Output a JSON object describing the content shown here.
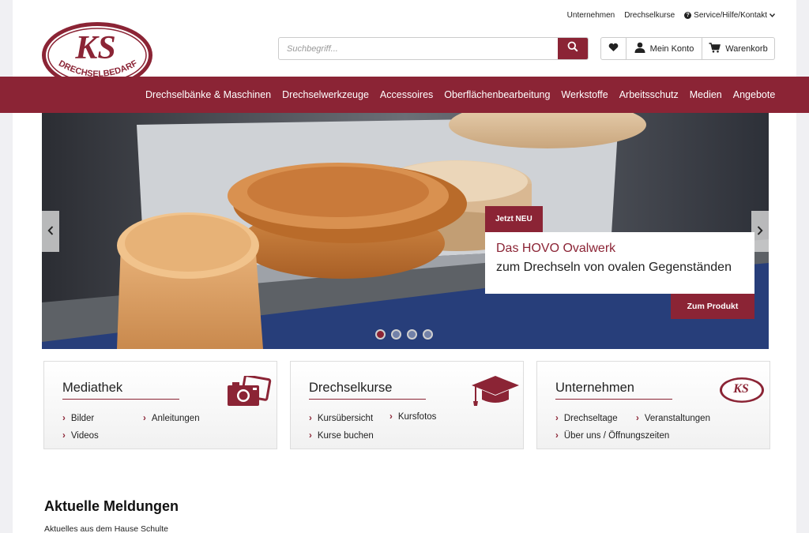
{
  "top_links": {
    "company": "Unternehmen",
    "courses": "Drechselkurse",
    "service": "Service/Hilfe/Kontakt"
  },
  "logo": {
    "initials": "KS",
    "name": "DRECHSELBEDARF"
  },
  "search": {
    "placeholder": "Suchbegriff..."
  },
  "account": {
    "my_account": "Mein Konto",
    "cart": "Warenkorb"
  },
  "nav": {
    "items": [
      "Drechselbänke & Maschinen",
      "Drechselwerkzeuge",
      "Accessoires",
      "Oberflächenbearbeitung",
      "Werkstoffe",
      "Arbeitsschutz",
      "Medien",
      "Angebote"
    ]
  },
  "hero": {
    "tag": "Jetzt NEU",
    "line1": "Das HOVO Ovalwerk",
    "line2": "zum Drechseln von ovalen Gegenständen",
    "cta": "Zum Produkt",
    "slide_count": 4,
    "active_slide": 1
  },
  "cards": [
    {
      "title": "Mediathek",
      "links": [
        "Bilder",
        "Anleitungen",
        "Videos"
      ]
    },
    {
      "title": "Drechselkurse",
      "links": [
        "Kursübersicht",
        "Kursfotos",
        "Kurse buchen"
      ]
    },
    {
      "title": "Unternehmen",
      "links": [
        "Drechseltage",
        "Veranstaltungen",
        "Über uns / Öffnungszeiten"
      ]
    }
  ],
  "news": {
    "heading": "Aktuelle Meldungen",
    "subheading": "Aktuelles aus dem Hause Schulte"
  },
  "colors": {
    "brand": "#8b2435",
    "background": "#f0f0f3"
  }
}
